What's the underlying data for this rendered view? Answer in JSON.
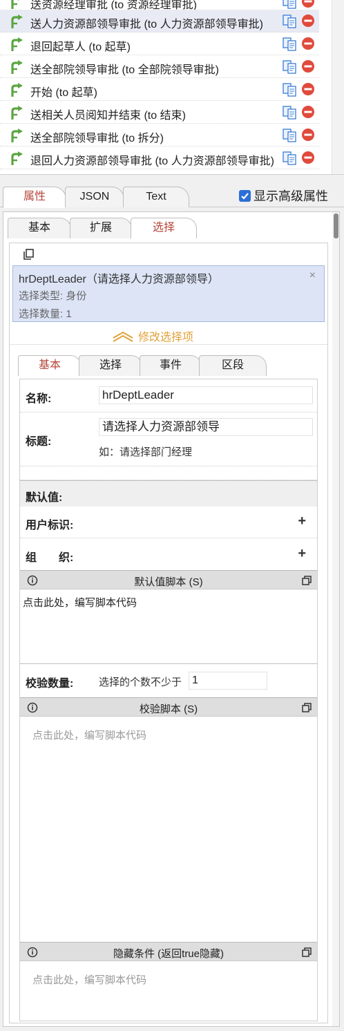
{
  "routes": [
    {
      "label": "送资源经理审批 (to 资源经理审批)",
      "selected": false
    },
    {
      "label": "送人力资源部领导审批 (to 人力资源部领导审批)",
      "selected": true
    },
    {
      "label": "退回起草人 (to 起草)",
      "selected": false
    },
    {
      "label": "送全部院领导审批 (to 全部院领导审批)",
      "selected": false
    },
    {
      "label": "开始 (to 起草)",
      "selected": false
    },
    {
      "label": "送相关人员阅知并结束 (to 结束)",
      "selected": false
    },
    {
      "label": "送全部院领导审批 (to 拆分)",
      "selected": false
    },
    {
      "label": "退回人力资源部领导审批 (to 人力资源部领导审批)",
      "selected": false
    },
    {
      "label": "",
      "selected": false
    }
  ],
  "icons": {
    "route": "route-arrow-icon",
    "copy": "copy-icon",
    "delete": "delete-icon"
  },
  "main_tabs": [
    {
      "label": "属性",
      "active": true
    },
    {
      "label": "JSON",
      "active": false
    },
    {
      "label": "Text",
      "active": false
    }
  ],
  "show_advanced": {
    "label": "显示高级属性",
    "checked": true
  },
  "prop_tabs": [
    {
      "label": "基本",
      "active": false
    },
    {
      "label": "扩展",
      "active": false
    },
    {
      "label": "选择",
      "active": true
    }
  ],
  "selection": {
    "name": "hrDeptLeader（请选择人力资源部领导）",
    "type": "选择类型: 身份",
    "count": "选择数量: 1",
    "close": "×"
  },
  "modify_label": "修改选择项",
  "inner_tabs": [
    {
      "label": "基本",
      "active": true
    },
    {
      "label": "选择",
      "active": false
    },
    {
      "label": "事件",
      "active": false
    },
    {
      "label": "区段",
      "active": false
    }
  ],
  "form": {
    "name_label": "名称:",
    "name_value": "hrDeptLeader",
    "title_label": "标题:",
    "title_value": "请选择人力资源部领导",
    "title_hint": "如：请选择部门经理",
    "default_label": "默认值:",
    "user_label": "用户标识:",
    "org_label": "组　　织:",
    "plus": "+",
    "default_script_title": "默认值脚本 (S)",
    "default_script_text": "点击此处，编写脚本代码",
    "validate_count_label": "校验数量:",
    "validate_count_prefix": "选择的个数不少于",
    "validate_count_value": "1",
    "validate_script_title": "校验脚本 (S)",
    "validate_script_placeholder": "点击此处，编写脚本代码",
    "hide_cond_title": "隐藏条件 (返回true隐藏)",
    "hide_cond_placeholder": "点击此处，编写脚本代码"
  },
  "colors": {
    "active_tab_text": "#b5463a",
    "route_arrow": "#5aa542",
    "delete_red": "#e04a3c",
    "copy_blue": "#3a7bd5",
    "selection_bg": "#dce4f6",
    "modify_link": "#e0a23a"
  }
}
